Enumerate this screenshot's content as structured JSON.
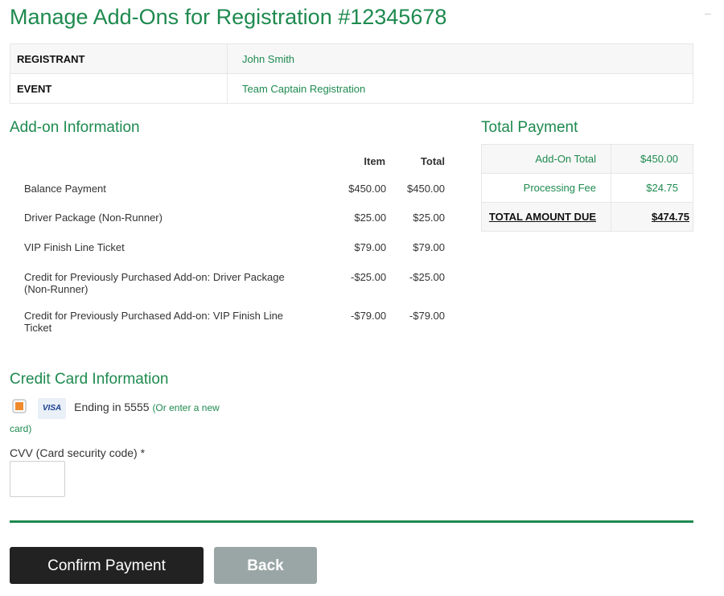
{
  "page": {
    "title": "Manage Add-Ons for Registration #12345678"
  },
  "registration": {
    "rows": [
      {
        "label": "REGISTRANT",
        "value": "John Smith"
      },
      {
        "label": "EVENT",
        "value": "Team Captain Registration"
      }
    ]
  },
  "addons": {
    "heading": "Add-on Information",
    "columns": {
      "item": "Item",
      "total": "Total"
    },
    "rows": [
      {
        "name": "Balance Payment",
        "item": "$450.00",
        "total": "$450.00"
      },
      {
        "name": "Driver Package (Non-Runner)",
        "item": "$25.00",
        "total": "$25.00"
      },
      {
        "name": "VIP Finish Line Ticket",
        "item": "$79.00",
        "total": "$79.00"
      },
      {
        "name": "Credit for Previously Purchased Add-on: Driver Package (Non-Runner)",
        "item": "-$25.00",
        "total": "-$25.00"
      },
      {
        "name": "Credit for Previously Purchased Add-on: VIP Finish Line Ticket",
        "item": "-$79.00",
        "total": "-$79.00"
      }
    ]
  },
  "payment": {
    "heading": "Total Payment",
    "rows": [
      {
        "label": "Add-On Total",
        "value": "$450.00"
      },
      {
        "label": "Processing Fee",
        "value": "$24.75"
      },
      {
        "label": "TOTAL AMOUNT DUE",
        "value": "$474.75"
      }
    ]
  },
  "credit_card": {
    "heading": "Credit Card Information",
    "brand": "VISA",
    "ending": "Ending in 5555",
    "new_card_link": "(Or enter a new card)",
    "cvv_label": "CVV (Card security code) *",
    "cvv_value": "",
    "selected": true
  },
  "buttons": {
    "confirm": "Confirm Payment",
    "back": "Back"
  },
  "colors": {
    "accent": "#1e8a4f",
    "confirm_bg": "#222222",
    "back_bg": "#9aa6a5",
    "radio": "#f08a2c"
  }
}
